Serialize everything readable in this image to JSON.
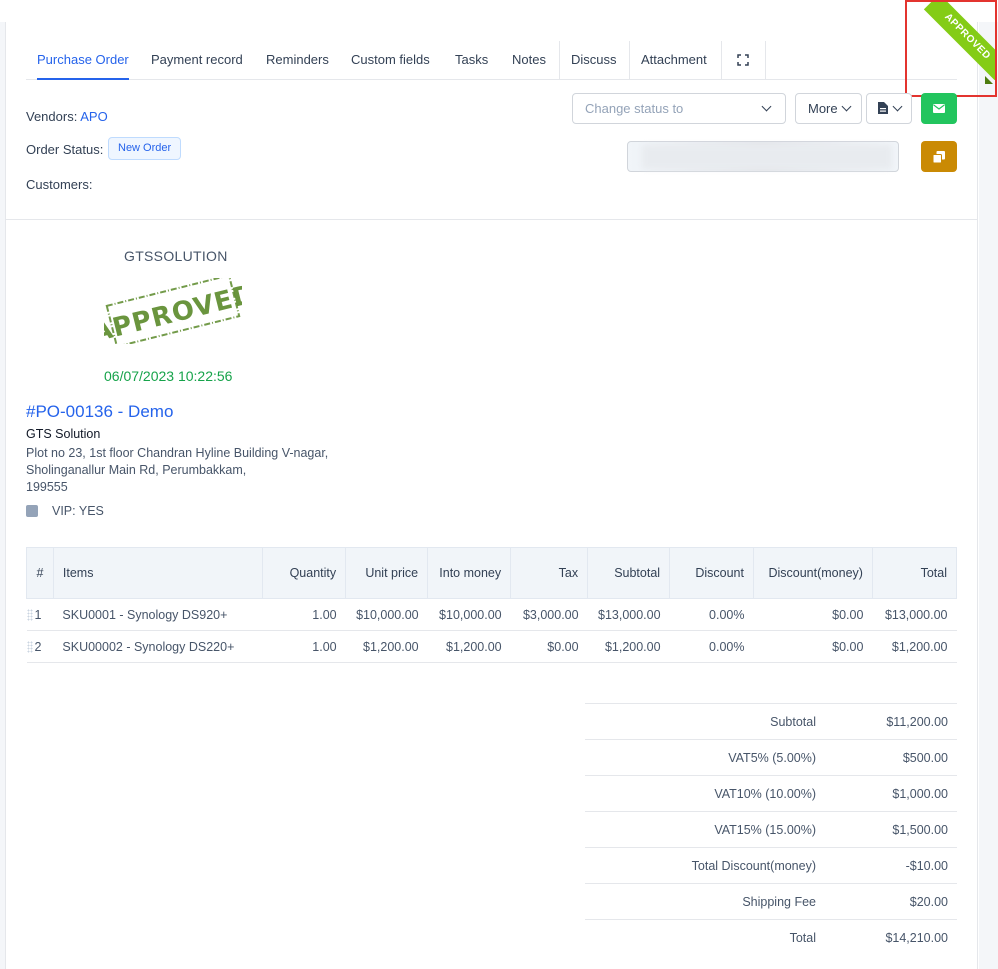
{
  "tabs": [
    {
      "label": "Purchase Order"
    },
    {
      "label": "Payment record"
    },
    {
      "label": "Reminders"
    },
    {
      "label": "Custom fields"
    },
    {
      "label": "Tasks"
    },
    {
      "label": "Notes"
    },
    {
      "label": "Discuss"
    },
    {
      "label": "Attachment"
    }
  ],
  "ribbon": {
    "label": "APPROVED"
  },
  "header": {
    "vendors_label": "Vendors:",
    "vendors_value": "APO",
    "order_status_label": "Order Status:",
    "order_status_value": "New Order",
    "customers_label": "Customers:"
  },
  "controls": {
    "status_placeholder": "Change status to",
    "more_label": "More",
    "icons": [
      "chevron-down-icon",
      "pdf-icon",
      "envelope-icon",
      "copy-icon",
      "expand-icon"
    ]
  },
  "stamp": {
    "company": "GTSSOLUTION",
    "text": "APPROVED",
    "datetime": "06/07/2023 10:22:56"
  },
  "po": {
    "title": "#PO-00136 - Demo",
    "company": "GTS Solution",
    "address_lines": [
      "Plot no 23, 1st floor Chandran Hyline Building V-nagar,",
      "Sholinganallur Main Rd, Perumbakkam,",
      "199555"
    ],
    "vip": "VIP: YES"
  },
  "items_table": {
    "headers": [
      "#",
      "Items",
      "Quantity",
      "Unit price",
      "Into money",
      "Tax",
      "Subtotal",
      "Discount",
      "Discount(money)",
      "Total"
    ],
    "rows": [
      [
        "1",
        "SKU0001 - Synology DS920+",
        "1.00",
        "$10,000.00",
        "$10,000.00",
        "$3,000.00",
        "$13,000.00",
        "0.00%",
        "$0.00",
        "$13,000.00"
      ],
      [
        "2",
        "SKU00002 - Synology DS220+",
        "1.00",
        "$1,200.00",
        "$1,200.00",
        "$0.00",
        "$1,200.00",
        "0.00%",
        "$0.00",
        "$1,200.00"
      ]
    ]
  },
  "totals": [
    {
      "label": "Subtotal",
      "value": "$11,200.00"
    },
    {
      "label": "VAT5% (5.00%)",
      "value": "$500.00"
    },
    {
      "label": "VAT10% (10.00%)",
      "value": "$1,000.00"
    },
    {
      "label": "VAT15% (15.00%)",
      "value": "$1,500.00"
    },
    {
      "label": "Total Discount(money)",
      "value": "-$10.00"
    },
    {
      "label": "Shipping Fee",
      "value": "$20.00"
    },
    {
      "label": "Total",
      "value": "$14,210.00"
    }
  ],
  "colors": {
    "accent": "#2563eb",
    "approved_green": "#84cc16",
    "stamp_green": "#5a8a2a",
    "send_button": "#22c55e",
    "copy_button": "#ca8a04",
    "highlight_box": "#e3342f"
  }
}
